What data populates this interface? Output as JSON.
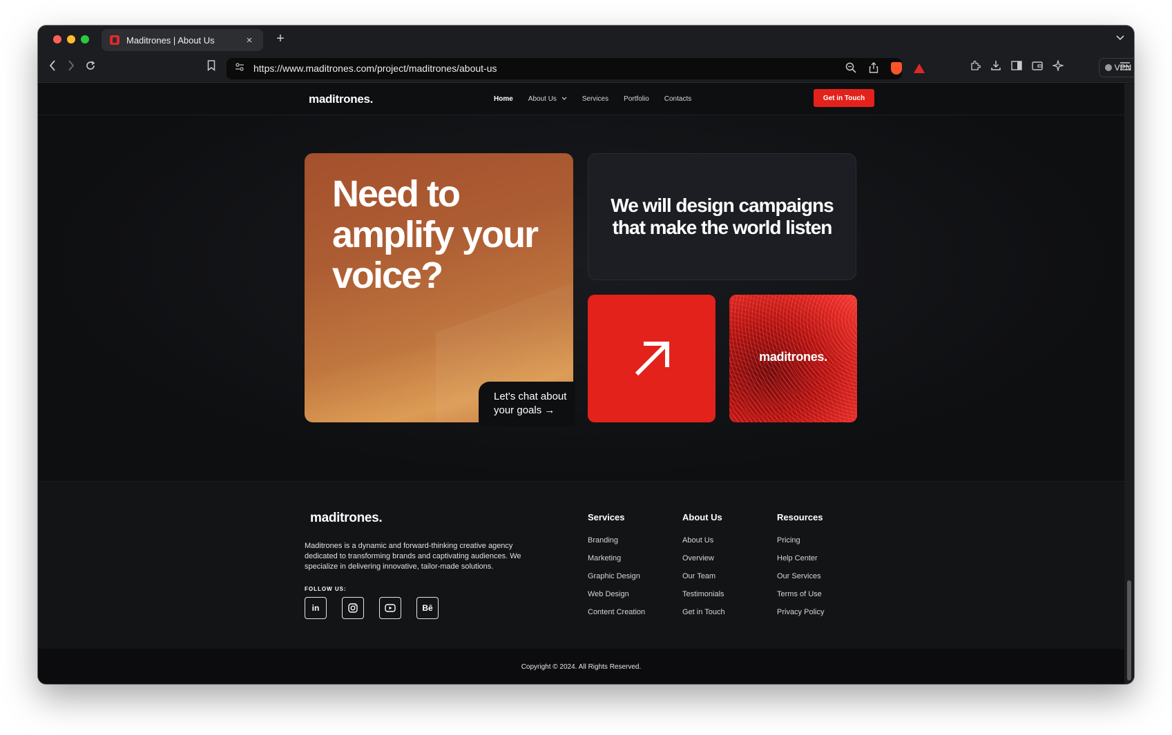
{
  "browser": {
    "tab_title": "Maditrones | About Us",
    "tab_close": "×",
    "new_tab": "+",
    "url": "https://www.maditrones.com/project/maditrones/about-us",
    "vpn_label": "VPN"
  },
  "header": {
    "logo": "maditrones.",
    "nav": [
      "Home",
      "About Us",
      "Services",
      "Portfolio",
      "Contacts"
    ],
    "about_chevron": "⌄",
    "cta": "Get in Touch"
  },
  "hero": {
    "headline": "Need to amplify your voice?",
    "chat_link": "Let's chat about your goals →",
    "campaign_text": "We will design campaigns that make the world listen",
    "logo_card_text": "maditrones."
  },
  "footer": {
    "logo": "maditrones.",
    "about": "Maditrones is a dynamic and forward-thinking creative agency dedicated to transforming brands and captivating audiences. We specialize in delivering innovative, tailor-made solutions.",
    "follow_label": "FOLLOW US:",
    "socials": [
      "in",
      "◎",
      "▶",
      "Bē"
    ],
    "columns": [
      {
        "title": "Services",
        "links": [
          "Branding",
          "Marketing",
          "Graphic Design",
          "Web Design",
          "Content Creation"
        ]
      },
      {
        "title": "About Us",
        "links": [
          "About Us",
          "Overview",
          "Our Team",
          "Testimonials",
          "Get in Touch"
        ]
      },
      {
        "title": "Resources",
        "links": [
          "Pricing",
          "Help Center",
          "Our Services",
          "Terms of Use",
          "Privacy Policy"
        ]
      }
    ],
    "copyright": "Copyright © 2024. All Rights Reserved."
  },
  "colors": {
    "accent_red": "#e3221b",
    "page_bg": "#0e0f11",
    "orange_card": "#b8693a"
  }
}
